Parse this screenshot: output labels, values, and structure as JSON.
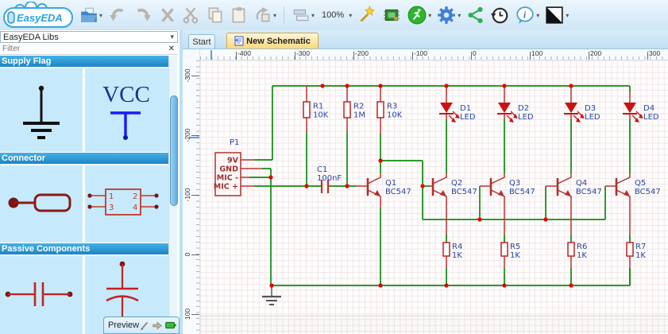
{
  "ui": {
    "dropdown_arrow": "▾",
    "close_x": "✕",
    "zoom_level": "100%"
  },
  "logo": {
    "text": "EasyEDA"
  },
  "tabs": {
    "start": "Start",
    "active": "New Schematic"
  },
  "sidebar": {
    "libs_dropdown": "EasyEDA Libs",
    "filter_placeholder": "Filter",
    "sections": [
      {
        "title": "Supply Flag"
      },
      {
        "title": "Connector"
      },
      {
        "title": "Passive Components"
      }
    ],
    "vcc_label": "VCC",
    "connector_pins": [
      "1",
      "2",
      "3",
      "4"
    ],
    "preview_label": "Preview"
  },
  "rulers": {
    "horizontal": [
      "-400",
      "-300",
      "-200",
      "-100",
      "0",
      "100",
      "200",
      "300"
    ],
    "vertical": [
      "-300",
      "-200",
      "-100",
      "0",
      "100"
    ]
  },
  "schematic": {
    "connector": {
      "ref": "P1",
      "pins": [
        "9V",
        "GND",
        "MIC -",
        "MIC +"
      ]
    },
    "capacitor": {
      "ref": "C1",
      "value": "100nF"
    },
    "resistors": [
      {
        "ref": "R1",
        "value": "10K"
      },
      {
        "ref": "R2",
        "value": "1M"
      },
      {
        "ref": "R3",
        "value": "10K"
      },
      {
        "ref": "R4",
        "value": "1K"
      },
      {
        "ref": "R5",
        "value": "1K"
      },
      {
        "ref": "R6",
        "value": "1K"
      },
      {
        "ref": "R7",
        "value": "1K"
      }
    ],
    "leds": [
      {
        "ref": "D1",
        "value": "LED"
      },
      {
        "ref": "D2",
        "value": "LED"
      },
      {
        "ref": "D3",
        "value": "LED"
      },
      {
        "ref": "D4",
        "value": "LED"
      }
    ],
    "transistors": [
      {
        "ref": "Q1",
        "value": "BC547"
      },
      {
        "ref": "Q2",
        "value": "BC547"
      },
      {
        "ref": "Q3",
        "value": "BC547"
      },
      {
        "ref": "Q4",
        "value": "BC547"
      },
      {
        "ref": "Q5",
        "value": "BC547"
      }
    ],
    "colors": {
      "wire_green": "#0e8c0e",
      "component_red": "#c03030",
      "junction_red": "#e60000",
      "label_blue": "#2646a6",
      "pin_text_red": "#a03030"
    }
  }
}
